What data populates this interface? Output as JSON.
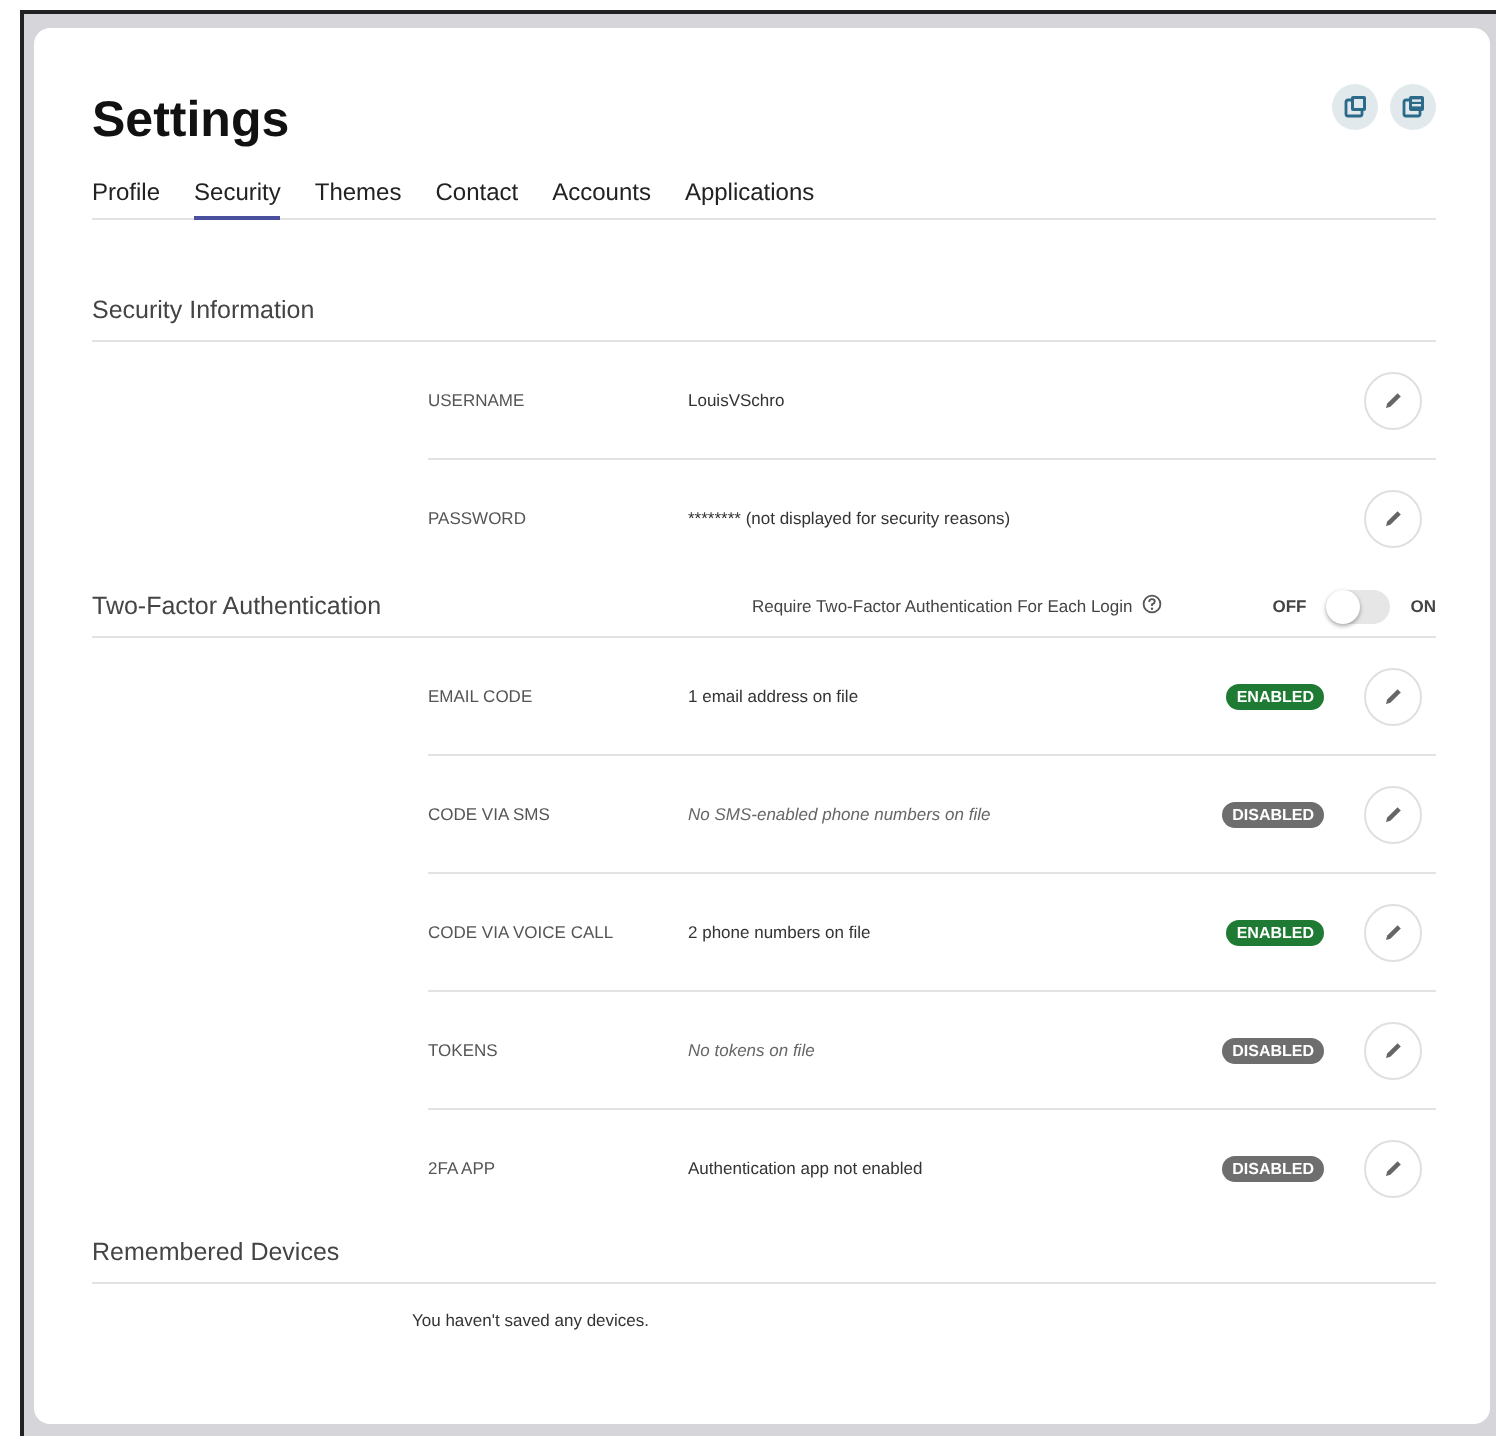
{
  "title": "Settings",
  "tabs": [
    {
      "label": "Profile",
      "selected": false
    },
    {
      "label": "Security",
      "selected": true
    },
    {
      "label": "Themes",
      "selected": false
    },
    {
      "label": "Contact",
      "selected": false
    },
    {
      "label": "Accounts",
      "selected": false
    },
    {
      "label": "Applications",
      "selected": false
    }
  ],
  "security_information": {
    "heading": "Security Information",
    "rows": [
      {
        "label": "USERNAME",
        "value": "LouisVSchro",
        "empty": false
      },
      {
        "label": "PASSWORD",
        "value": "******** (not displayed for security reasons)",
        "empty": false
      }
    ]
  },
  "two_factor": {
    "heading": "Two-Factor Authentication",
    "requirement": "Require Two-Factor Authentication For Each Login",
    "toggle": {
      "off_label": "OFF",
      "on_label": "ON",
      "on": false
    },
    "rows": [
      {
        "label": "EMAIL CODE",
        "value": "1 email address on file",
        "empty": false,
        "status": "ENABLED",
        "enabled": true
      },
      {
        "label": "CODE VIA SMS",
        "value": "No SMS-enabled phone numbers on file",
        "empty": true,
        "status": "DISABLED",
        "enabled": false
      },
      {
        "label": "CODE VIA VOICE CALL",
        "value": "2 phone numbers on file",
        "empty": false,
        "status": "ENABLED",
        "enabled": true
      },
      {
        "label": "TOKENS",
        "value": "No tokens on file",
        "empty": true,
        "status": "DISABLED",
        "enabled": false
      },
      {
        "label": "2FA APP",
        "value": "Authentication app not enabled",
        "empty": false,
        "status": "DISABLED",
        "enabled": false
      }
    ]
  },
  "remembered_devices": {
    "heading": "Remembered Devices",
    "message": "You haven't saved any devices."
  }
}
